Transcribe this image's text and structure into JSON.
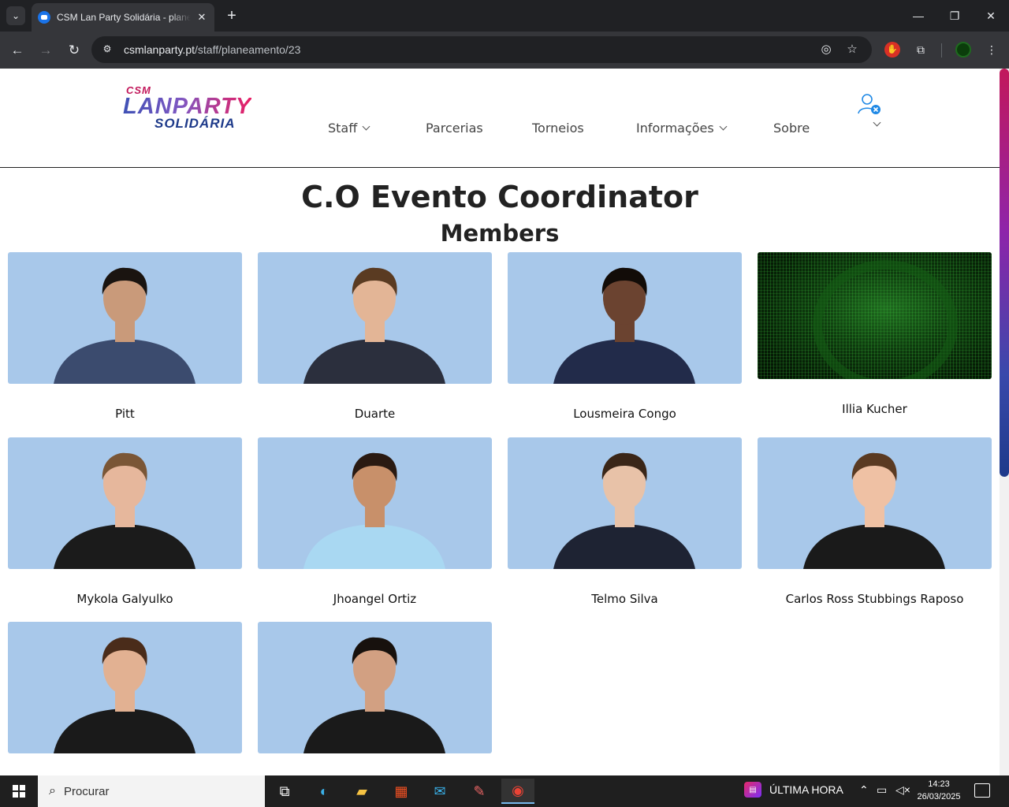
{
  "browser": {
    "tab_title": "CSM Lan Party Solidária - planeamento",
    "url_domain": "csmlanparty.pt",
    "url_path": "/staff/planeamento/23"
  },
  "site": {
    "logo_csm": "CSM",
    "logo_lanparty": "LANPARTY",
    "logo_solidaria": "SOLIDÁRIA",
    "nav": [
      {
        "label": "Staff",
        "has_dropdown": true
      },
      {
        "label": "Parcerias",
        "has_dropdown": false
      },
      {
        "label": "Torneios",
        "has_dropdown": false
      },
      {
        "label": "Informações",
        "has_dropdown": true
      },
      {
        "label": "Sobre",
        "has_dropdown": false
      }
    ]
  },
  "main": {
    "title": "C.O Evento Coordinator",
    "subtitle": "Members",
    "members": [
      {
        "name": "Pitt",
        "shirt": "#3b4b6e",
        "hair": "#1a1410",
        "skin": "#c99a7a"
      },
      {
        "name": "Duarte",
        "shirt": "#2b2f3d",
        "hair": "#5a3b22",
        "skin": "#e3b596"
      },
      {
        "name": "Lousmeira Congo",
        "shirt": "#222b4a",
        "hair": "#120c08",
        "skin": "#6b4330"
      },
      {
        "name": "Illia Kucher",
        "shirt": "",
        "hair": "",
        "skin": ""
      },
      {
        "name": "Mykola Galyulko",
        "shirt": "#1b1b1b",
        "hair": "#7a5636",
        "skin": "#e6b79c"
      },
      {
        "name": "Jhoangel Ortiz",
        "shirt": "#a9d8f2",
        "hair": "#2a1a12",
        "skin": "#c8906a"
      },
      {
        "name": "Telmo Silva",
        "shirt": "#1e2333",
        "hair": "#3a2618",
        "skin": "#e8c2a8"
      },
      {
        "name": "Carlos Ross Stubbings Raposo",
        "shirt": "#1a1a1a",
        "hair": "#5a3a22",
        "skin": "#efc1a4"
      },
      {
        "name": "",
        "shirt": "#1a1a1a",
        "hair": "#4a2c1a",
        "skin": "#e2b192"
      },
      {
        "name": "",
        "shirt": "#1a1a1a",
        "hair": "#17110d",
        "skin": "#d2a082"
      }
    ]
  },
  "taskbar": {
    "search_placeholder": "Procurar",
    "news_label": "ÚLTIMA HORA",
    "time": "14:23",
    "date": "26/03/2025"
  },
  "colors": {
    "photo_background": "#a8c8ea",
    "chrome_dark": "#202124",
    "chrome_toolbar": "#35363a",
    "accent_magenta": "#c2185b",
    "accent_navy": "#1e3a8a"
  }
}
